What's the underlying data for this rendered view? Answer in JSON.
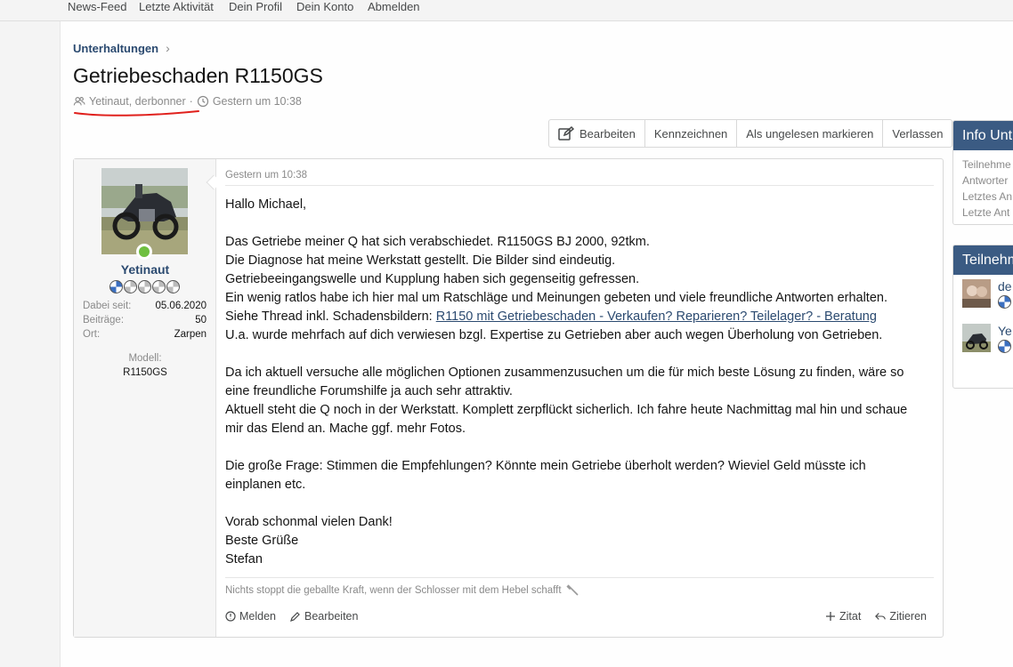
{
  "topnav": [
    "News-Feed",
    "Letzte Aktivität",
    "Dein Profil",
    "Dein Konto",
    "Abmelden"
  ],
  "breadcrumb": "Unterhaltungen",
  "title": "Getriebeschaden R1150GS",
  "meta": {
    "participants": "Yetinaut, derbonner",
    "separator": "·",
    "time": "Gestern um 10:38"
  },
  "toolbar": [
    "Bearbeiten",
    "Kennzeichnen",
    "Als ungelesen markieren",
    "Verlassen"
  ],
  "user": {
    "name": "Yetinaut",
    "stats": [
      {
        "k": "Dabei seit:",
        "v": "05.06.2020"
      },
      {
        "k": "Beiträge:",
        "v": "50"
      },
      {
        "k": "Ort:",
        "v": "Zarpen"
      }
    ],
    "model_label": "Modell:",
    "model_value": "R1150GS"
  },
  "post": {
    "date": "Gestern um 10:38",
    "greeting": "Hallo Michael,",
    "p1": [
      "Das Getriebe meiner Q hat sich verabschiedet. R1150GS BJ 2000, 92tkm.",
      "Die Diagnose hat meine Werkstatt gestellt. Die Bilder sind eindeutig.",
      "Getriebeeingangswelle und Kupplung haben sich gegenseitig gefressen.",
      "Ein wenig ratlos habe ich hier mal um Ratschläge und Meinungen gebeten und viele freundliche Antworten erhalten."
    ],
    "link_prefix": "Siehe Thread inkl. Schadensbildern: ",
    "link_text": "R1150 mit Getriebeschaden - Verkaufen? Reparieren? Teilelager? - Beratung",
    "p1_last": "U.a. wurde mehrfach auf dich verwiesen bzgl. Expertise zu Getrieben aber auch wegen Überholung von Getrieben.",
    "p2": [
      "Da ich aktuell versuche alle möglichen Optionen zusammenzusuchen um die für mich beste Lösung zu finden, wäre so",
      "eine freundliche Forumshilfe ja auch sehr attraktiv.",
      "Aktuell steht die Q noch in der Werkstatt. Komplett zerpflückt sicherlich. Ich fahre heute Nachmittag mal hin und schaue",
      "mir das Elend an. Mache ggf. mehr Fotos."
    ],
    "p3": [
      "Die große Frage: Stimmen die Empfehlungen? Könnte mein Getriebe überholt werden? Wieviel Geld müsste ich",
      "einplanen etc."
    ],
    "p4": [
      "Vorab schonmal vielen Dank!",
      "Beste Grüße",
      "Stefan"
    ],
    "signature": "Nichts stoppt die geballte Kraft, wenn der Schlosser mit dem Hebel schafft",
    "actions_left": [
      "Melden",
      "Bearbeiten"
    ],
    "actions_right": [
      "Zitat",
      "Zitieren"
    ]
  },
  "sidebar": {
    "info_title": "Info Unt",
    "info_rows": [
      "Teilnehme",
      "Antworter",
      "Letztes An",
      "Letzte Ant"
    ],
    "members_title": "Teilnehm",
    "members": [
      "de",
      "Ye"
    ]
  },
  "colors": {
    "accent": "#3b5b83",
    "link": "#2b4a70",
    "online": "#6fbf40",
    "annotation": "#e0201c"
  }
}
